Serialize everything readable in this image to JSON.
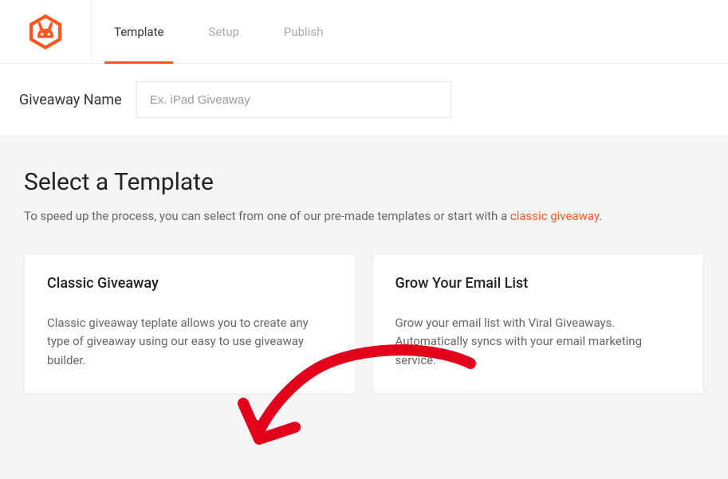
{
  "colors": {
    "accent": "#ff5722"
  },
  "tabs": {
    "template": "Template",
    "setup": "Setup",
    "publish": "Publish"
  },
  "nameBar": {
    "label": "Giveaway Name",
    "placeholder": "Ex. iPad Giveaway",
    "value": ""
  },
  "section": {
    "title": "Select a Template",
    "subPrefix": "To speed up the process, you can select from one of our pre-made templates or start with a ",
    "subLink": "classic giveaway",
    "subSuffix": "."
  },
  "cards": {
    "classic": {
      "title": "Classic Giveaway",
      "desc": "Classic giveaway teplate allows you to create any type of giveaway using our easy to use giveaway builder."
    },
    "email": {
      "title": "Grow Your Email List",
      "desc": "Grow your email list with Viral Giveaways. Automatically syncs with your email marketing service."
    }
  }
}
